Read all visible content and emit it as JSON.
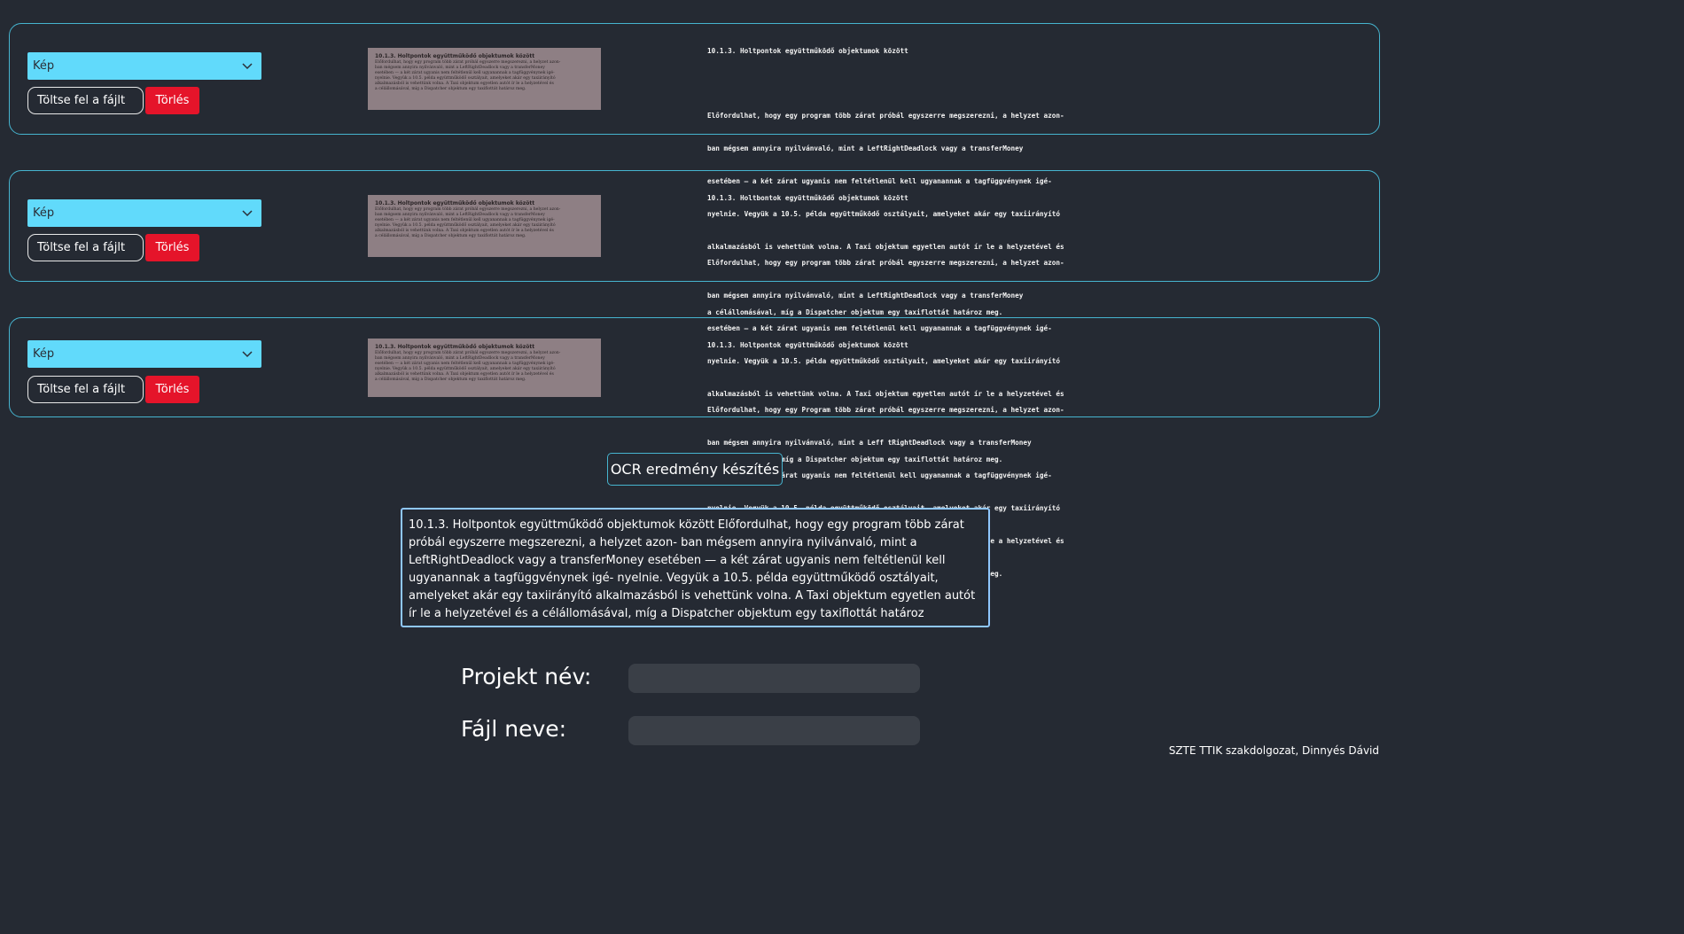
{
  "rows": [
    {
      "select_value": "Kép",
      "upload_label": "Töltse fel a fájlt",
      "delete_label": "Törlés",
      "thumb_lines": [
        "10.1.3. Holtpontok együttműködő objektumok között",
        "Előfordulhat, hogy egy program több zárat próbál egyszerre megszerezni, a helyzet azon-",
        "ban mégsem annyira nyilvánvaló, mint a LeftRightDeadlock vagy a transferMoney",
        "esetében — a két zárat ugyanis nem feltétlenül kell ugyanannak a tagfüggvénynek igé-",
        "nyelnie. Vegyük a 10.5. példa együttműködő osztályait, amelyeket akár egy taxiirányító",
        "alkalmazásból is vehettünk volna. A Taxi objektum egyetlen autót ír le a helyzetével és",
        "a célállomásával, míg a Dispatcher objektum egy taxiflottát határoz meg."
      ],
      "ocr_lines": [
        "10.1.3. Holtpontok együttműködő objektumok között",
        "",
        "Előfordulhat, hogy egy program több zárat próbál egyszerre megszerezni, a helyzet azon-",
        "ban mégsem annyira nyilvánvaló, mint a LeftRightDeadlock vagy a transferMoney",
        "esetében — a két zárat ugyanis nem feltétlenül kell ugyanannak a tagfüggvénynek igé-",
        "nyelnie. Vegyük a 10.5. példa együttműködő osztályait, amelyeket akár egy taxiirányító",
        "alkalmazásból is vehettünk volna. A Taxi objektum egyetlen autót ír le a helyzetével és",
        "",
        "a célállomásával, míg a Dispatcher objektum egy taxiflottát határoz meg."
      ]
    },
    {
      "select_value": "Kép",
      "upload_label": "Töltse fel a fájlt",
      "delete_label": "Törlés",
      "thumb_lines": [
        "10.1.3. Holtpontok együttműködő objektumok között",
        "Előfordulhat, hogy egy program több zárat próbál egyszerre megszerezni, a helyzet azon-",
        "ban mégsem annyira nyilvánvaló, mint a LeftRightDeadlock vagy a transferMoney",
        "esetében — a két zárat ugyanis nem feltétlenül kell ugyanannak a tagfüggvénynek igé-",
        "nyelnie. Vegyük a 10.5. példa együttműködő osztályait, amelyeket akár egy taxiirányító",
        "alkalmazásból is vehettünk volna. A Taxi objektum egyetlen autót ír le a helyzetével és",
        "a célállomásával, míg a Dispatcher objektum egy taxiflottát határoz meg."
      ],
      "ocr_lines": [
        "10.1.3. Holtbontok együttműködő objektumok között",
        "",
        "Előfordulhat, hogy egy program több zárat próbál egyszerre megszerezni, a helyzet azon-",
        "ban mégsem annyira nyilvánvaló, mint a LeftRightDeadlock vagy a transferMoney",
        "esetében — a két zárat ugyanis nem feltétlenül kell ugyanannak a tagfüggvénynek igé-",
        "nyelnie. Vegyük a 10.5. példa együttműködő osztályait, amelyeket akár egy taxiirányító",
        "alkalmazásból is vehettünk volna. A Taxi objektum egyetlen autót ír le a helyzetével és",
        "",
        "a célállomásával, míg a Dispatcher objektum egy taxiflottát határoz meg."
      ]
    },
    {
      "select_value": "Kép",
      "upload_label": "Töltse fel a fájlt",
      "delete_label": "Törlés",
      "thumb_lines": [
        "10.1.3. Holtpontok együttműködő objektumok között",
        "Előfordulhat, hogy egy program több zárat próbál egyszerre megszerezni, a helyzet azon-",
        "ban mégsem annyira nyilvánvaló, mint a LeftRightDeadlock vagy a transferMoney",
        "esetében — a két zárat ugyanis nem feltétlenül kell ugyanannak a tagfüggvénynek igé-",
        "nyelnie. Vegyük a 10.5. példa együttműködő osztályait, amelyeket akár egy taxiirányító",
        "alkalmazásból is vehettünk volna. A Taxi objektum egyetlen autót ír le a helyzetével és",
        "a célállomásával, míg a Dispatcher objektum egy taxiflottát határoz meg."
      ],
      "ocr_lines": [
        "10.1.3. Holtpontok együttműködő objektumok között",
        "",
        "Előfordulhat, hogy egy Program több zárat próbál egyszerre megszerezni, a helyzet azon-",
        "ban mégsem annyira nyilvánvaló, mint a Leff tRightDeadlock vagy a transferMoney",
        "esetében — a két zárat ugyanis nem feltétlenül kell ugyanannak a tagfüggvénynek igé-",
        "nyelnie. Vegyük a 10.5. példa együttműködő osztályait, amelyeket akár egy taxiirányító",
        "alkalmazásból is vehettünk volna. A Taxi objektum egyetlen autót ír le a helyzetével és",
        "a célállomásával, míg a Dispatcher objektum egy taxiflottát határoz meg."
      ]
    }
  ],
  "ocr_button_label": "OCR eredmény készítés",
  "result_text": "10.1.3. Holtpontok együttműködő objektumok között  Előfordulhat, hogy egy program több zárat próbál egyszerre megszerezni, a helyzet azon- ban mégsem annyira nyilvánvaló, mint a LeftRightDeadlock vagy a transferMoney esetében — a két zárat ugyanis nem feltétlenül kell ugyanannak a tagfüggvénynek igé- nyelnie. Vegyük a 10.5. példa együttműködő osztályait, amelyeket akár egy taxiirányító alkalmazásból is vehettünk volna. A Taxi objektum egyetlen autót ír le a helyzetével és  a célállomásával, míg a Dispatcher objektum egy taxiflottát határoz",
  "form": {
    "project_label": "Projekt név:",
    "project_value": "",
    "file_label": "Fájl neve:",
    "file_value": ""
  },
  "footer": "SZTE TTIK szakdolgozat, Dinnyés Dávid",
  "colors": {
    "background": "#252a33",
    "accent": "#61dafb",
    "border": "#46b4cf",
    "danger": "#e5142a"
  },
  "icons": {
    "select_arrow": "chevron-down-icon"
  }
}
